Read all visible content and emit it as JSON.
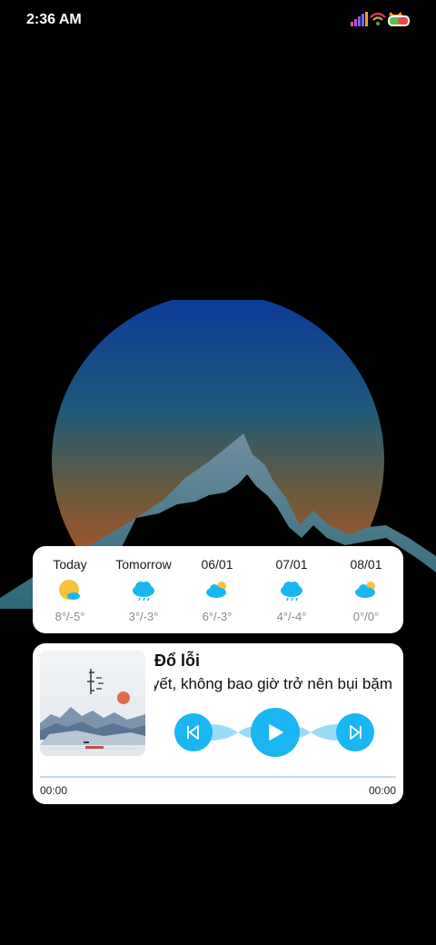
{
  "status_bar": {
    "time": "2:36 AM",
    "icons": [
      "signal-icon",
      "wifi-icon",
      "battery-icon"
    ]
  },
  "weather": {
    "days": [
      {
        "label": "Today",
        "temps": "8°/-5°",
        "icon": "sun-cloud-icon"
      },
      {
        "label": "Tomorrow",
        "temps": "3°/-3°",
        "icon": "rain-cloud-icon"
      },
      {
        "label": "06/01",
        "temps": "6°/-3°",
        "icon": "partly-cloudy-icon"
      },
      {
        "label": "07/01",
        "temps": "4°/-4°",
        "icon": "rain-cloud-icon"
      },
      {
        "label": "08/01",
        "temps": "0°/0°",
        "icon": "partly-cloudy-icon"
      }
    ]
  },
  "music": {
    "title": "Đổ lỗi",
    "lyric": "uyết, không bao giờ trở nên bụi bặm",
    "time_elapsed": "00:00",
    "time_total": "00:00",
    "progress": 0,
    "controls": {
      "prev": "previous-icon",
      "play": "play-icon",
      "next": "next-icon"
    }
  },
  "colors": {
    "accent": "#19b6f2",
    "accent_light": "#9adcf8",
    "sun": "#f5c23c"
  }
}
